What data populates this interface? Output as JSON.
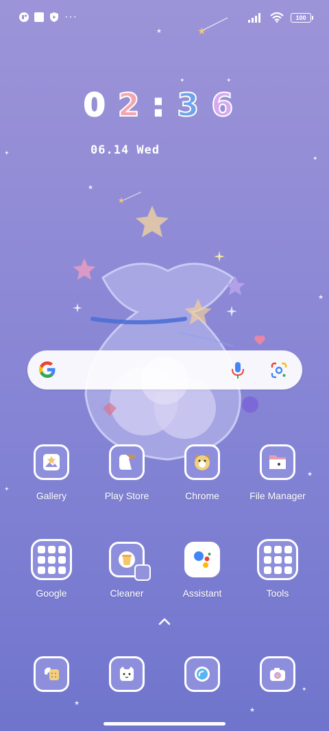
{
  "status_bar": {
    "left_icons": [
      "app-notification-icon",
      "square-notification-icon",
      "shield-play-icon"
    ],
    "more": "···",
    "battery": "100"
  },
  "clock": {
    "h1": "0",
    "h2": "2",
    "sep": ":",
    "m1": "3",
    "m2": "6"
  },
  "date": "06.14 Wed",
  "search": {
    "logo": "G"
  },
  "apps": {
    "gallery": "Gallery",
    "play_store": "Play Store",
    "chrome": "Chrome",
    "file_manager": "File Manager",
    "google": "Google",
    "cleaner": "Cleaner",
    "assistant": "Assistant",
    "tools": "Tools"
  },
  "dock": [
    "phone-icon",
    "messages-icon",
    "browser-icon",
    "camera-icon"
  ]
}
